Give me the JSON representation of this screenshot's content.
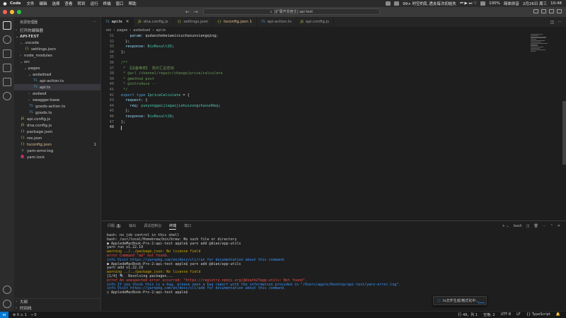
{
  "menubar": {
    "app_name": "Code",
    "items": [
      "文件",
      "编辑",
      "选择",
      "查看",
      "转到",
      "运行",
      "终端",
      "窗口",
      "帮助"
    ],
    "status_text": "99+ 时空的乱 透支每次初始失",
    "battery": "100%",
    "input_method": "简体拼音",
    "date": "2月26日 周三",
    "time": "10:48"
  },
  "titlebar": {
    "command_center": "[扩展开发宿主] api-test"
  },
  "sidebar": {
    "title": "资源管理器",
    "open_editors": "打开的编辑器",
    "project": "API-TEST",
    "tree": [
      {
        "label": ".vscode",
        "type": "folder",
        "depth": 1,
        "open": true
      },
      {
        "label": "settings.json",
        "type": "json",
        "depth": 2
      },
      {
        "label": "node_modules",
        "type": "folder",
        "depth": 1,
        "open": false
      },
      {
        "label": "src",
        "type": "folder",
        "depth": 1,
        "open": true
      },
      {
        "label": "pages",
        "type": "folder",
        "depth": 2,
        "open": true
      },
      {
        "label": "asdadsad",
        "type": "folder",
        "depth": 3,
        "open": true
      },
      {
        "label": "api-action.ts",
        "type": "ts",
        "depth": 4
      },
      {
        "label": "api.ts",
        "type": "ts",
        "depth": 4,
        "selected": true
      },
      {
        "label": "asdasd",
        "type": "folder",
        "depth": 3,
        "open": false
      },
      {
        "label": "swagger-base",
        "type": "folder",
        "depth": 3,
        "open": false
      },
      {
        "label": "goods-action.ts",
        "type": "ts",
        "depth": 3
      },
      {
        "label": "goods.ts",
        "type": "ts",
        "depth": 3
      },
      {
        "label": "api.config.js",
        "type": "js",
        "depth": 1
      },
      {
        "label": "dna.config.js",
        "type": "js",
        "depth": 1
      },
      {
        "label": "package.json",
        "type": "json",
        "depth": 1
      },
      {
        "label": "res.json",
        "type": "json",
        "depth": 1
      },
      {
        "label": "tsconfig.json",
        "type": "json",
        "depth": 1,
        "modified": true,
        "badge": "1"
      },
      {
        "label": "yarn-error.log",
        "type": "log",
        "depth": 1
      },
      {
        "label": "yarn.lock",
        "type": "lock",
        "depth": 1
      }
    ],
    "outline": "大纲",
    "timeline": "时间线"
  },
  "tabs": [
    {
      "label": "api.ts",
      "icon": "TS",
      "active": true,
      "close": "✕"
    },
    {
      "label": "dna.config.js",
      "icon": "JS"
    },
    {
      "label": "settings.json",
      "icon": "{}"
    },
    {
      "label": "tsconfig.json 1",
      "icon": "{}",
      "error": true
    },
    {
      "label": "api-action.ts",
      "icon": "TS"
    },
    {
      "label": "api.config.js",
      "icon": "JS"
    }
  ],
  "breadcrumb": [
    "src",
    "pages",
    "asdadsad",
    "api.ts"
  ],
  "editor": {
    "lines": [
      {
        "n": "31",
        "code": [
          [
            "pu",
            "    "
          ],
          [
            "pr",
            "param"
          ],
          [
            "pu",
            ": qudaoshebeiweixiuchaxunxiangqing;"
          ]
        ]
      },
      {
        "n": "32",
        "code": [
          [
            "pu",
            "  };"
          ]
        ]
      },
      {
        "n": "33",
        "code": [
          [
            "pu",
            "  "
          ],
          [
            "pr",
            "response"
          ],
          [
            "pu",
            ": "
          ],
          [
            "ty",
            "BizResult26"
          ],
          [
            "pu",
            ";"
          ]
        ]
      },
      {
        "n": "34",
        "code": [
          [
            "pu",
            "};"
          ]
        ]
      },
      {
        "n": "35",
        "code": []
      },
      {
        "n": "36",
        "code": [
          [
            "cm",
            "/**"
          ]
        ]
      },
      {
        "n": "37",
        "code": [
          [
            "cm",
            " * 【设备维修】 改价汇总查询"
          ]
        ]
      },
      {
        "n": "38",
        "code": [
          [
            "cm",
            " * @url /channel/repair/change/price/calculate"
          ]
        ]
      },
      {
        "n": "39",
        "code": [
          [
            "cm",
            " * @method post"
          ]
        ]
      },
      {
        "n": "40",
        "code": [
          [
            "cm",
            " * @introduce --"
          ]
        ]
      },
      {
        "n": "41",
        "code": [
          [
            "cm",
            " */"
          ]
        ]
      },
      {
        "n": "42",
        "code": [
          [
            "kw",
            "export type "
          ],
          [
            "ty",
            "IpriceCalculate"
          ],
          [
            "pu",
            " = {"
          ]
        ]
      },
      {
        "n": "43",
        "code": [
          [
            "pu",
            "  "
          ],
          [
            "pr",
            "request"
          ],
          [
            "pu",
            ": {"
          ]
        ]
      },
      {
        "n": "44",
        "code": [
          [
            "pu",
            "    "
          ],
          [
            "pr",
            "req"
          ],
          [
            "pu",
            ": "
          ],
          [
            "ty",
            "yunyonggaijiagaijiahuizongchaxunReq"
          ],
          [
            "pu",
            ";"
          ]
        ]
      },
      {
        "n": "45",
        "code": [
          [
            "pu",
            "  };"
          ]
        ]
      },
      {
        "n": "46",
        "code": [
          [
            "pu",
            "  "
          ],
          [
            "pr",
            "response"
          ],
          [
            "pu",
            ": "
          ],
          [
            "ty",
            "BizResult28"
          ],
          [
            "pu",
            ";"
          ]
        ]
      },
      {
        "n": "47",
        "code": [
          [
            "pu",
            "};"
          ]
        ]
      },
      {
        "n": "48",
        "code": [],
        "current": true
      }
    ]
  },
  "panel": {
    "tabs": [
      {
        "label": "问题",
        "count": "1"
      },
      {
        "label": "输出"
      },
      {
        "label": "调试控制台"
      },
      {
        "label": "终端",
        "active": true
      },
      {
        "label": "端口"
      }
    ],
    "shell": "bash",
    "terminal": [
      {
        "cls": "",
        "text": "bash: no job control in this shell"
      },
      {
        "cls": "",
        "text": "bash: /usr/local/Homebrew/bin/brew: No such file or directory"
      },
      {
        "cls": "",
        "text": "● AppledeMacBook-Pro-2:api-test apple$ yarn add @dian/app-utils"
      },
      {
        "cls": "",
        "text": "yarn run v1.22.19"
      },
      {
        "cls": "t-warn",
        "text": "warning ../../package.json: No license field"
      },
      {
        "cls": "t-err",
        "text": "error Command \"ad\" not found."
      },
      {
        "cls": "t-info",
        "text": "info Visit https://yarnpkg.com/en/docs/cli/run for documentation about this command."
      },
      {
        "cls": "",
        "text": "● AppledeMacBook-Pro-2:api-test apple$ yarn add @dian/app-utils"
      },
      {
        "cls": "",
        "text": "yarn add v1.22.19"
      },
      {
        "cls": "t-warn",
        "text": "warning ../../package.json: No license field"
      },
      {
        "cls": "",
        "text": "[1/4] 🔍  Resolving packages..."
      },
      {
        "cls": "t-err",
        "text": "error An unexpected error occurred: \"https://registry.npmjs.org/@dian%2fapp-utils: Not found\"."
      },
      {
        "cls": "t-info",
        "text": "info If you think this is a bug, please open a bug report with the information provided in \"/Users/apple/Desktop/api-test/yarn-error.log\"."
      },
      {
        "cls": "t-info",
        "text": "info Visit https://yarnpkg.com/en/docs/cli/add for documentation about this command."
      },
      {
        "cls": "",
        "text": "○ AppledeMacBook-Pro-2:api-test apple$ "
      }
    ],
    "notification": "ts文件生成/格式化中..."
  },
  "statusbar": {
    "problems": "⊗ 0 ⚠ 1",
    "ports": "⑂ 0",
    "position": "行 48，列 1",
    "spaces": "空格: 2",
    "encoding": "UTF-8",
    "eol": "LF",
    "language": "{} TypeScript"
  },
  "colors": {
    "accent": "#0078d4",
    "error": "#f14c4c",
    "warning": "#cca700",
    "info": "#3794ff"
  }
}
